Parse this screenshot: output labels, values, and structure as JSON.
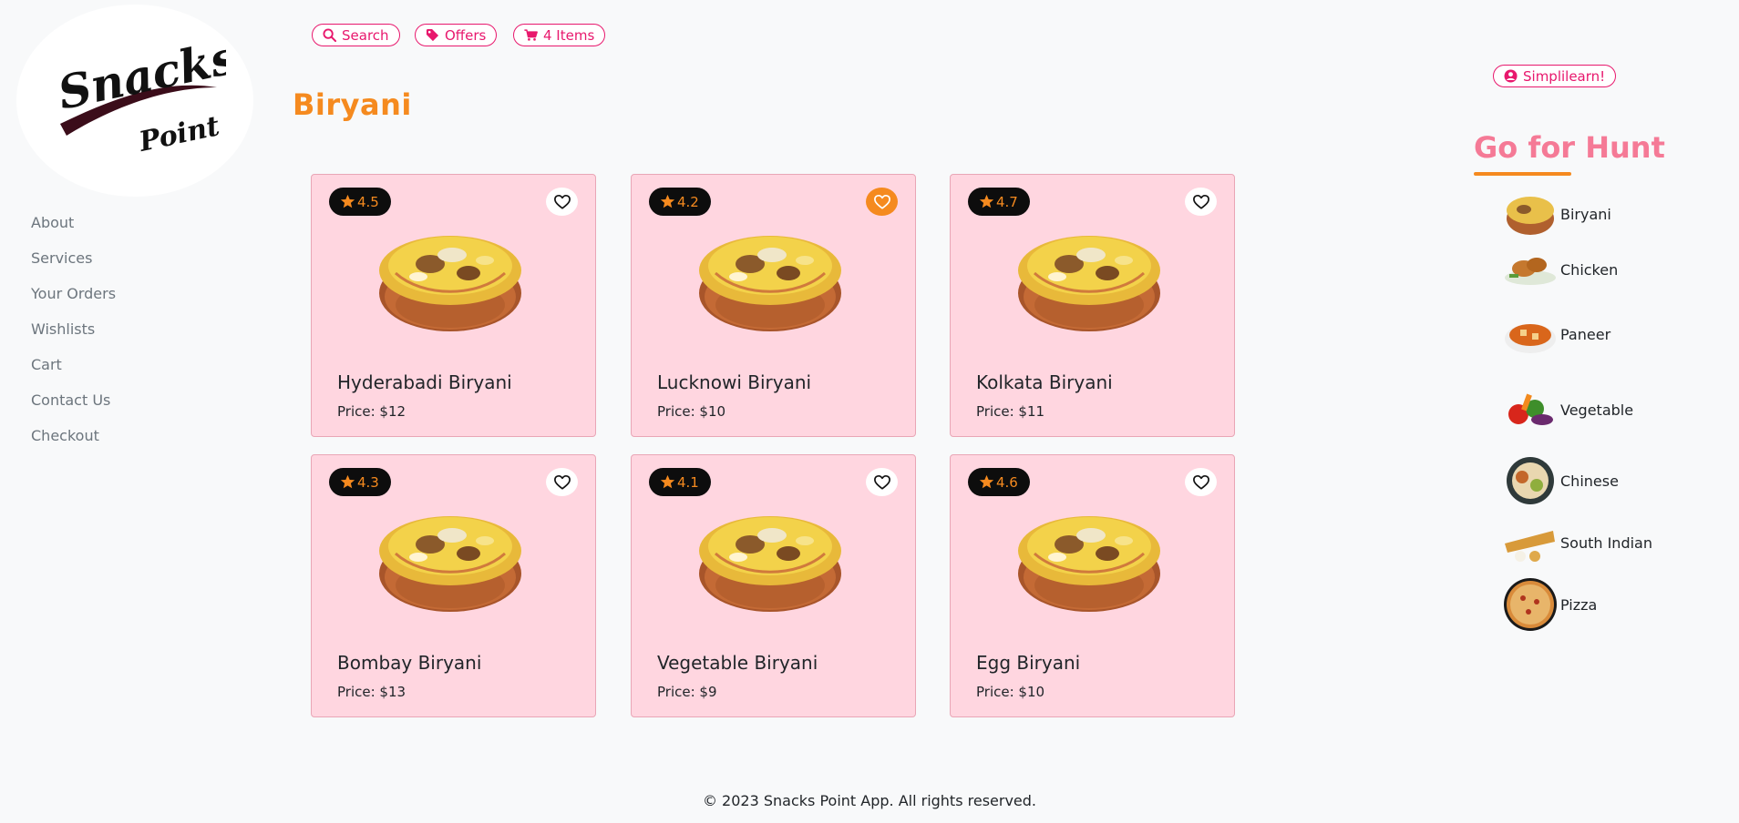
{
  "brand": {
    "logo_line1": "Snacks",
    "logo_line2": "Point"
  },
  "sidebar": {
    "items": [
      {
        "label": "About"
      },
      {
        "label": "Services"
      },
      {
        "label": "Your Orders"
      },
      {
        "label": "Wishlists"
      },
      {
        "label": "Cart"
      },
      {
        "label": "Contact Us"
      },
      {
        "label": "Checkout"
      }
    ]
  },
  "topbar": {
    "search_label": "Search",
    "offers_label": "Offers",
    "cart_label": "4 Items"
  },
  "user": {
    "label": "Simplilearn!"
  },
  "page": {
    "title": "Biryani"
  },
  "products": [
    {
      "rating": "4.5",
      "name": "Hyderabadi Biryani",
      "price": "Price: $12",
      "favorite": false
    },
    {
      "rating": "4.2",
      "name": "Lucknowi Biryani",
      "price": "Price: $10",
      "favorite": true
    },
    {
      "rating": "4.7",
      "name": "Kolkata Biryani",
      "price": "Price: $11",
      "favorite": false
    },
    {
      "rating": "4.3",
      "name": "Bombay Biryani",
      "price": "Price: $13",
      "favorite": false
    },
    {
      "rating": "4.1",
      "name": "Vegetable Biryani",
      "price": "Price: $9",
      "favorite": false
    },
    {
      "rating": "4.6",
      "name": "Egg Biryani",
      "price": "Price: $10",
      "favorite": false
    }
  ],
  "hunt": {
    "title": "Go for Hunt",
    "categories": [
      {
        "label": "Biryani",
        "icon": "biryani-icon"
      },
      {
        "label": "Chicken",
        "icon": "chicken-icon"
      },
      {
        "label": "Paneer",
        "icon": "paneer-icon"
      },
      {
        "label": "Vegetable",
        "icon": "vegetable-icon"
      },
      {
        "label": "Chinese",
        "icon": "chinese-icon"
      },
      {
        "label": "South Indian",
        "icon": "south-indian-icon"
      },
      {
        "label": "Pizza",
        "icon": "pizza-icon"
      }
    ]
  },
  "footer": {
    "text": "© 2023 Snacks Point App. All rights reserved."
  },
  "colors": {
    "accent_pink": "#e8186d",
    "accent_orange": "#f58a1f",
    "card_bg": "#ffd6e0",
    "hunt_title": "#f57a96"
  }
}
